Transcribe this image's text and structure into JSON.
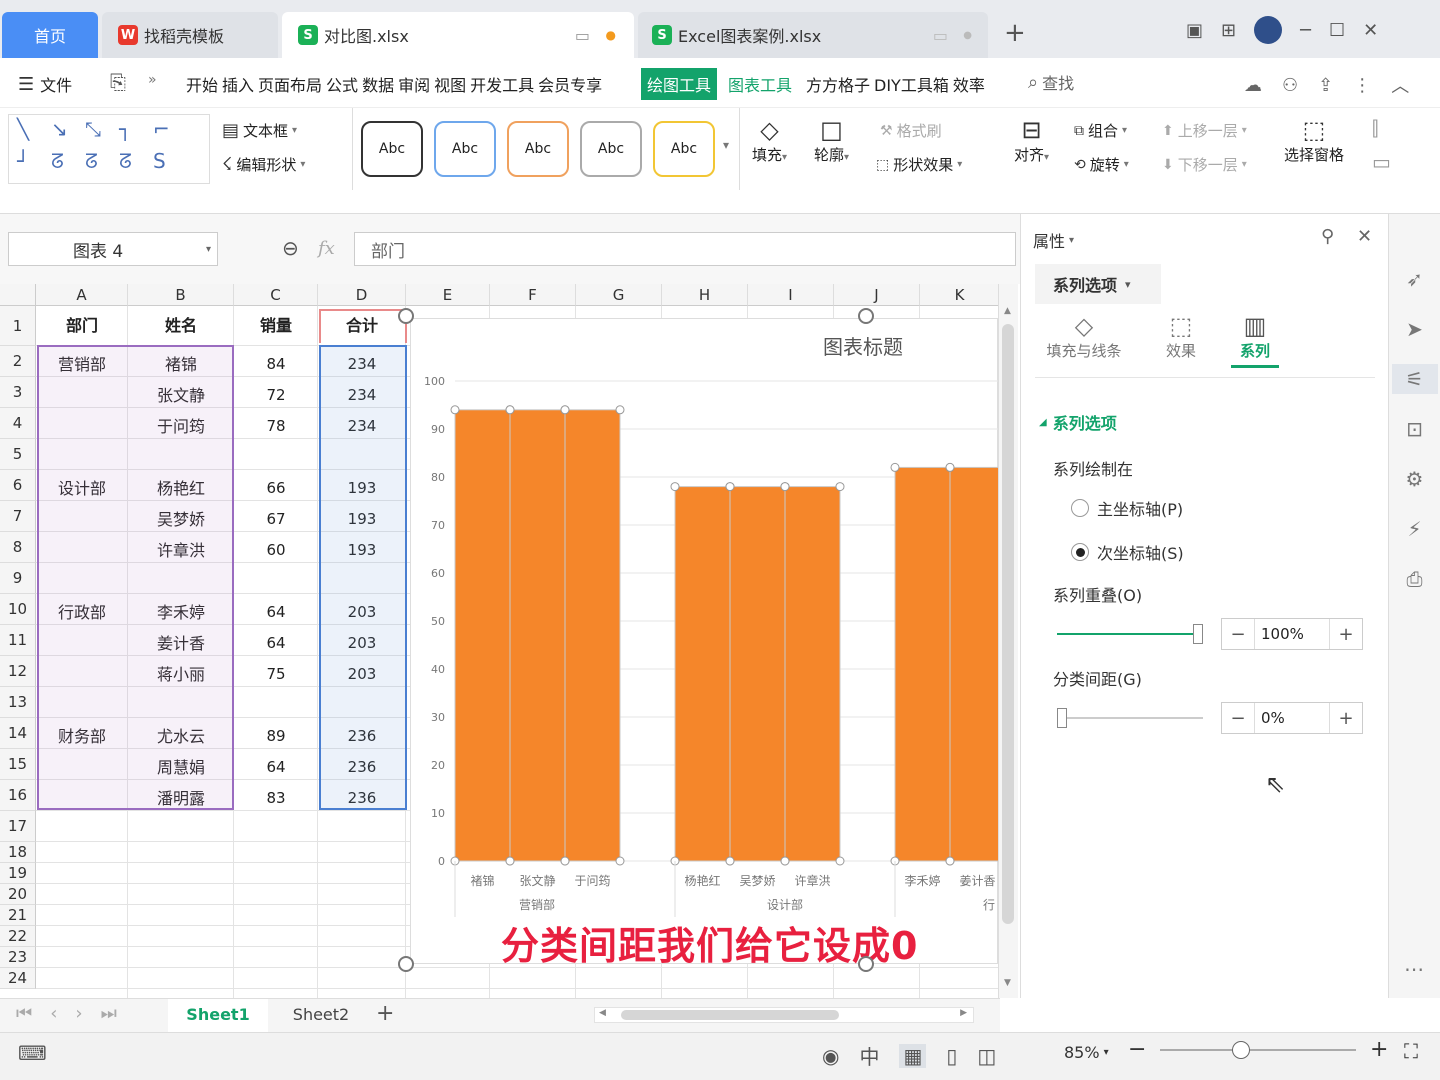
{
  "tabs": [
    {
      "label": "首页",
      "active": false
    },
    {
      "label": "找稻壳模板"
    },
    {
      "label": "对比图.xlsx",
      "active": true
    },
    {
      "label": "Excel图表案例.xlsx"
    }
  ],
  "menu": {
    "file": "文件",
    "items": [
      "开始",
      "插入",
      "页面布局",
      "公式",
      "数据",
      "审阅",
      "视图",
      "开发工具",
      "会员专享"
    ],
    "draw_tools": "绘图工具",
    "chart_tools": "图表工具",
    "extra": [
      "方方格子",
      "DIY工具箱",
      "效率"
    ],
    "search": "查找"
  },
  "ribbon": {
    "textbox": "文本框",
    "edit_shape": "编辑形状",
    "style_label": "Abc",
    "fill": "填充",
    "outline": "轮廓",
    "format_painter": "格式刷",
    "shape_effect": "形状效果",
    "align": "对齐",
    "group": "组合",
    "rotate": "旋转",
    "bring_forward": "上移一层",
    "send_backward": "下移一层",
    "select_pane": "选择窗格"
  },
  "formula": {
    "name_box": "图表 4",
    "fx": "fx",
    "content": "部门"
  },
  "sheet": {
    "columns": [
      "A",
      "B",
      "C",
      "D",
      "E",
      "F",
      "G",
      "H",
      "I",
      "J",
      "K"
    ],
    "header": [
      "部门",
      "姓名",
      "销量",
      "合计"
    ],
    "rows": [
      [
        "营销部",
        "褚锦",
        "84",
        "234"
      ],
      [
        "",
        "张文静",
        "72",
        "234"
      ],
      [
        "",
        "于问筠",
        "78",
        "234"
      ],
      [
        "",
        "",
        "",
        ""
      ],
      [
        "设计部",
        "杨艳红",
        "66",
        "193"
      ],
      [
        "",
        "吴梦娇",
        "67",
        "193"
      ],
      [
        "",
        "许章洪",
        "60",
        "193"
      ],
      [
        "",
        "",
        "",
        ""
      ],
      [
        "行政部",
        "李禾婷",
        "64",
        "203"
      ],
      [
        "",
        "姜计香",
        "64",
        "203"
      ],
      [
        "",
        "蒋小丽",
        "75",
        "203"
      ],
      [
        "",
        "",
        "",
        ""
      ],
      [
        "财务部",
        "尤水云",
        "89",
        "236"
      ],
      [
        "",
        "周慧娟",
        "64",
        "236"
      ],
      [
        "",
        "潘明露",
        "83",
        "236"
      ],
      [
        "",
        "",
        "",
        ""
      ],
      [
        "",
        "",
        "",
        ""
      ],
      [
        "",
        "",
        "",
        ""
      ],
      [
        "",
        "",
        "",
        ""
      ],
      [
        "",
        "",
        "",
        ""
      ],
      [
        "",
        "",
        "",
        ""
      ],
      [
        "",
        "",
        "",
        ""
      ],
      [
        "",
        "",
        "",
        ""
      ]
    ],
    "row_numbers": [
      "1",
      "2",
      "3",
      "4",
      "5",
      "6",
      "7",
      "8",
      "9",
      "10",
      "11",
      "12",
      "13",
      "14",
      "15",
      "16",
      "17",
      "18",
      "19",
      "20",
      "21",
      "22",
      "23",
      "24"
    ]
  },
  "chart_data": {
    "type": "bar",
    "title": "图表标题",
    "ylim": [
      0,
      100
    ],
    "yticks": [
      0,
      10,
      20,
      30,
      40,
      50,
      60,
      70,
      80,
      90,
      100
    ],
    "categories": [
      "褚锦",
      "张文静",
      "于问筠",
      "杨艳红",
      "吴梦娇",
      "许章洪",
      "李禾婷",
      "姜计香"
    ],
    "groups": [
      "营销部",
      "设计部",
      "行"
    ],
    "values": [
      94,
      94,
      94,
      78,
      78,
      78,
      82,
      82
    ],
    "color": "#f5862a",
    "grid": true
  },
  "caption": "分类间距我们给它设成0",
  "panel": {
    "title": "属性",
    "dropdown": "系列选项",
    "tabs": [
      "填充与线条",
      "效果",
      "系列"
    ],
    "section": "系列选项",
    "plot_on": "系列绘制在",
    "primary": "主坐标轴(P)",
    "secondary": "次坐标轴(S)",
    "overlap_label": "系列重叠(O)",
    "overlap_value": "100%",
    "overlap_fraction": 1.0,
    "gap_label": "分类间距(G)",
    "gap_value": "0%",
    "gap_fraction": 0.0,
    "accent": "#13a36b"
  },
  "sheet_tabs": [
    "Sheet1",
    "Sheet2"
  ],
  "status": {
    "zoom": "85%"
  }
}
